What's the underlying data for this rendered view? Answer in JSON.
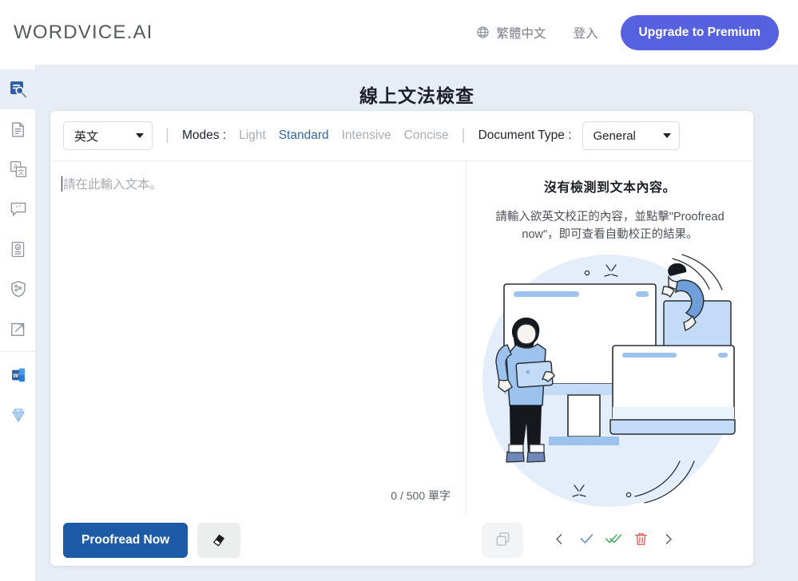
{
  "header": {
    "logo": "WORDVICE.AI",
    "language": "繁體中文",
    "login": "登入",
    "upgrade": "Upgrade to Premium",
    "globe_icon": "globe-icon"
  },
  "sidebar": {
    "items": [
      {
        "name": "proofreader",
        "icon": "proofread-search-icon",
        "active": true
      },
      {
        "name": "document",
        "icon": "document-icon",
        "active": false
      },
      {
        "name": "translate",
        "icon": "translate-icon",
        "active": false
      },
      {
        "name": "paraphrase",
        "icon": "quote-bubble-icon",
        "active": false
      },
      {
        "name": "summarize",
        "icon": "checked-document-icon",
        "active": false
      },
      {
        "name": "plagiarism",
        "icon": "shield-network-icon",
        "active": false
      },
      {
        "name": "open-external",
        "icon": "external-link-icon",
        "active": false
      },
      {
        "name": "word-addin",
        "icon": "word-icon",
        "active": false
      },
      {
        "name": "premium",
        "icon": "diamond-icon",
        "active": false
      }
    ]
  },
  "page": {
    "title": "線上文法檢查"
  },
  "toolbar": {
    "language_value": "英文",
    "modes_label": "Modes :",
    "modes": [
      {
        "label": "Light",
        "active": false
      },
      {
        "label": "Standard",
        "active": true
      },
      {
        "label": "Intensive",
        "active": false
      },
      {
        "label": "Concise",
        "active": false
      }
    ],
    "doc_type_label": "Document Type :",
    "doc_type_value": "General",
    "separator": "|"
  },
  "editor": {
    "placeholder": "請在此輸入文本。",
    "word_count": "0 / 500 單字"
  },
  "result": {
    "empty_title": "沒有檢測到文本內容。",
    "empty_desc": "請輸入欲英文校正的內容，並點擊\"Proofread now\"，即可查看自動校正的結果。"
  },
  "footer": {
    "proofread_label": "Proofread Now",
    "eraser_icon": "eraser-icon",
    "copy_icon": "copy-icon",
    "prev_icon": "chevron-left-icon",
    "accept_icon": "check-icon",
    "accept_all_icon": "double-check-icon",
    "delete_icon": "trash-icon",
    "next_icon": "chevron-right-icon"
  },
  "colors": {
    "accent_purple": "#5661e0",
    "accent_blue": "#1d5ba6",
    "mode_active": "#3468ae",
    "page_bg": "#e8ecf5",
    "illustration_blue": "#9dc2ee",
    "illustration_light": "#dceafa",
    "check_blue": "#5b8fc9",
    "check_green": "#3eae5e",
    "trash_red": "#e0524a"
  }
}
